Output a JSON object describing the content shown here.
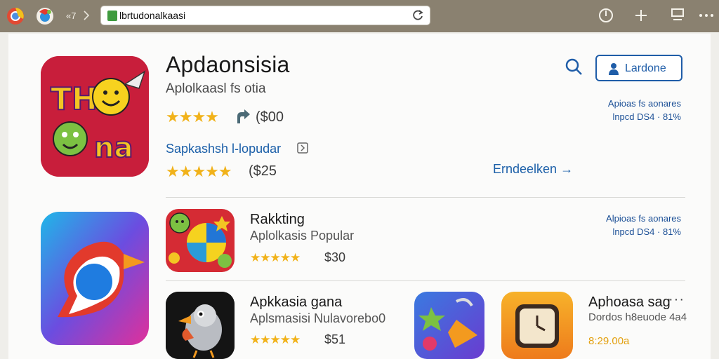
{
  "browser": {
    "url": "lbrtudonalkaasi",
    "tab_indicator": "«7"
  },
  "main_app": {
    "title": "Apdaonsisia",
    "subtitle": "Aplolkaasl fs otia",
    "rating_1": "★★★★",
    "price_1": "($00",
    "category": "Sapkashsh l-lopudar",
    "rating_2": "★★★★★",
    "price_2": "($25",
    "more_link": "Erndeelken →"
  },
  "header_actions": {
    "install_label": "Lardone"
  },
  "side_info_1": {
    "line1": "Apioas fs aonares",
    "line2": "lnpcd DS4 · 81%"
  },
  "ranking": {
    "name": "Rakkting",
    "desc": "Aplolkasis Popular",
    "rating": "★★★★★",
    "price": "$30"
  },
  "side_info_2": {
    "line1": "Alpioas fs aonares",
    "line2": "lnpcd DS4 · 81%"
  },
  "app_row_a": {
    "name": "Apkkasia gana",
    "desc": "Aplsmasisi Nulavorebo0",
    "rating": "★★★★★",
    "price": "$51"
  },
  "app_row_b": {
    "name": "Aphoasa sag",
    "desc": "Dordos h8euode 4a4",
    "price": "8:29.00a",
    "more": "···"
  }
}
